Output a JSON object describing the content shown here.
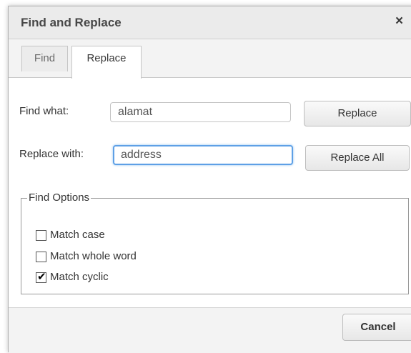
{
  "dialog": {
    "title": "Find and Replace",
    "close_glyph": "×"
  },
  "tabs": [
    {
      "label": "Find",
      "active": false
    },
    {
      "label": "Replace",
      "active": true
    }
  ],
  "form": {
    "find_label": "Find what:",
    "find_value": "alamat",
    "replace_label": "Replace with:",
    "replace_value": "address",
    "replace_button": "Replace",
    "replace_all_button": "Replace All"
  },
  "options": {
    "legend": "Find Options",
    "items": [
      {
        "label": "Match case",
        "checked": false
      },
      {
        "label": "Match whole word",
        "checked": false
      },
      {
        "label": "Match cyclic",
        "checked": true
      }
    ]
  },
  "footer": {
    "cancel_button": "Cancel"
  },
  "colors": {
    "focus_border": "#5ea0e6",
    "titlebar_bg": "#ebebeb"
  }
}
